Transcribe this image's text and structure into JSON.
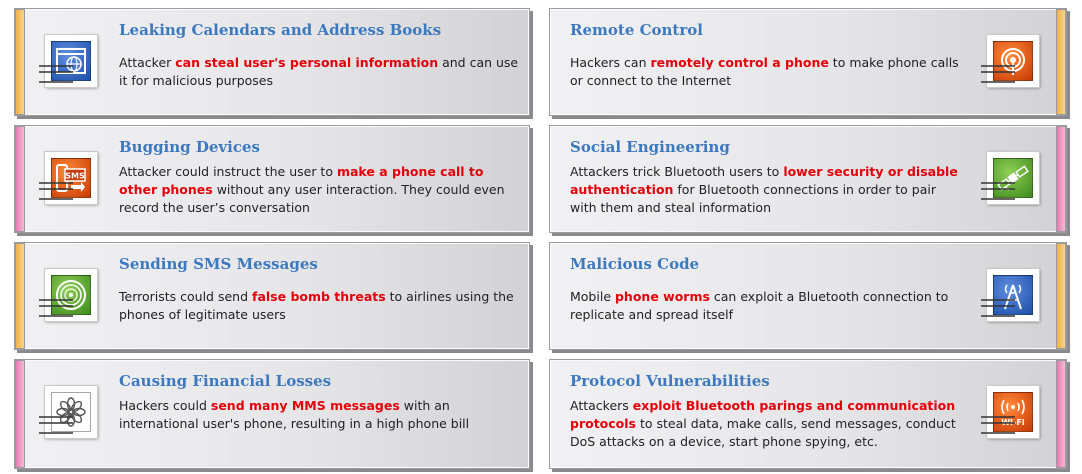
{
  "colors": {
    "title": "#3d79be",
    "highlight": "#e3000b",
    "text": "#222222",
    "orange_edge": "#f2b24a",
    "pink_edge": "#e87bb0"
  },
  "cards": [
    {
      "title": "Leaking Calendars and Address Books",
      "icon": "browser-globe-icon",
      "text_before": "Attacker ",
      "highlight": "can steal user's personal information",
      "text_after": " and can use it for malicious purposes"
    },
    {
      "title": "Remote Control",
      "icon": "broadcast-tower-icon",
      "text_before": "Hackers can ",
      "highlight": "remotely control a phone",
      "text_after": " to make phone calls or connect to the Internet"
    },
    {
      "title": "Bugging Devices",
      "icon": "sms-phone-icon",
      "text_before": "Attacker could instruct the user to ",
      "highlight": "make a phone call to other phones",
      "text_after": " without any user interaction. They could even record the user’s conversation"
    },
    {
      "title": "Social Engineering",
      "icon": "satellite-icon",
      "text_before": "Attackers trick Bluetooth users to ",
      "highlight": "lower security or disable authentication",
      "text_after": " for Bluetooth connections in order to pair with them and steal information"
    },
    {
      "title": "Sending SMS Messages",
      "icon": "rss-icon",
      "text_before": "Terrorists could send ",
      "highlight": "false bomb threats",
      "text_after": " to airlines using the phones of legitimate users"
    },
    {
      "title": "Malicious Code",
      "icon": "antenna-icon",
      "text_before": "Mobile ",
      "highlight": "phone worms",
      "text_after": " can exploit a Bluetooth connection to replicate and spread itself"
    },
    {
      "title": "Causing Financial Losses",
      "icon": "flower-icon",
      "text_before": "Hackers could ",
      "highlight": "send many MMS messages",
      "text_after": " with an international user's phone, resulting in a high phone bill"
    },
    {
      "title": "Protocol Vulnerabilities",
      "icon": "wifi-icon",
      "icon_text": "WI-FI",
      "sms_icon_text": "SMS",
      "text_before": "Attackers ",
      "highlight": "exploit Bluetooth parings and communication protocols",
      "text_after": " to steal data, make calls, send messages, conduct DoS attacks on a device, start phone spying, etc."
    }
  ]
}
